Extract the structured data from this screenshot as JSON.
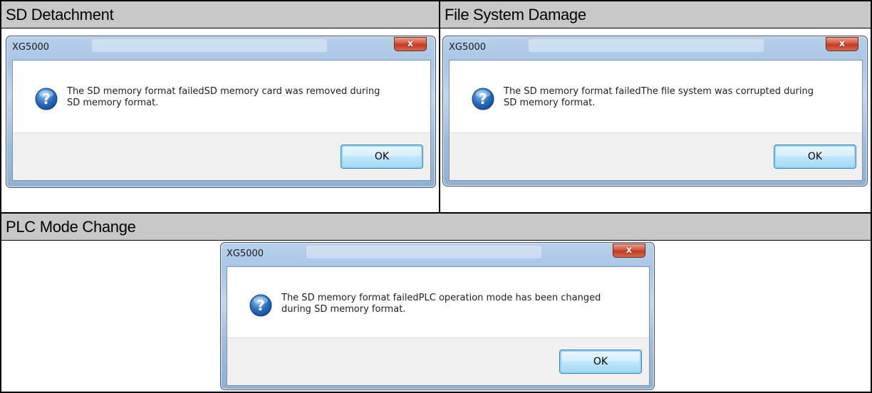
{
  "panels": [
    {
      "header": "SD Detachment",
      "dialog": {
        "title": "XG5000",
        "close": "x",
        "message_line1": "The SD memory format failedSD memory card was removed during",
        "message_line2": "SD memory format.",
        "ok": "OK"
      }
    },
    {
      "header": "File System Damage",
      "dialog": {
        "title": "XG5000",
        "close": "x",
        "message_line1": "The SD memory format failedThe file system was corrupted during",
        "message_line2": "SD memory format.",
        "ok": "OK"
      }
    },
    {
      "header": "PLC Mode Change",
      "dialog": {
        "title": "XG5000",
        "close": "x",
        "message_line1": "The SD memory format failedPLC operation mode has been changed",
        "message_line2": "during SD memory format.",
        "ok": "OK"
      }
    }
  ],
  "colors": {
    "header_bg": "#c8c8c8",
    "dialog_frame": "#a8c6e6",
    "close_button": "#c03a20",
    "ok_button": "#bee6fd",
    "question_icon": "#2a6fc0"
  },
  "icons": {
    "dialog_icon": "question-icon",
    "close_icon": "close-icon"
  }
}
